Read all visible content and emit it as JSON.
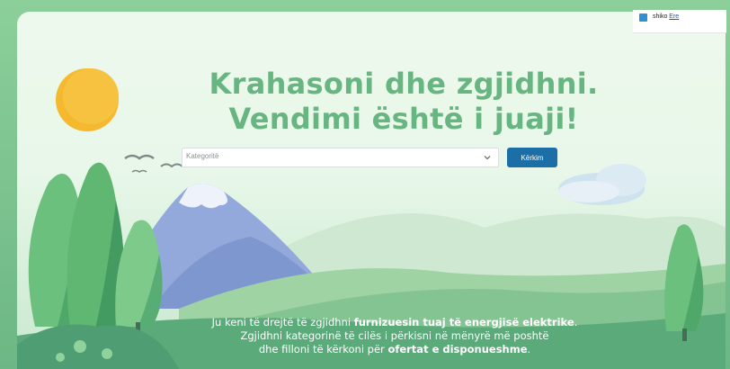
{
  "hero": {
    "title_line1": "Krahasoni dhe zgjidhni.",
    "title_line2": "Vendimi është i juaji!"
  },
  "search": {
    "category_placeholder": "Kategoritë",
    "search_button_label": "Kërkim"
  },
  "intro": {
    "line1_start": "Ju keni të drejtë të zgjidhni ",
    "line1_bold": "furnizuesin tuaj të energjisë elektrike",
    "line1_end": ".",
    "line2": "Zgjidhni kategorinë të cilës i përkisni në mënyrë më poshtë",
    "line3_start": "dhe filloni të kërkoni për ",
    "line3_bold": "ofertat e disponueshme",
    "line3_end": "."
  },
  "language": {
    "prefix": "shiko",
    "link": "Ere"
  },
  "colors": {
    "title_green": "#67b581",
    "button_blue": "#1b6fa6",
    "frame_green": "#7fc28e"
  }
}
